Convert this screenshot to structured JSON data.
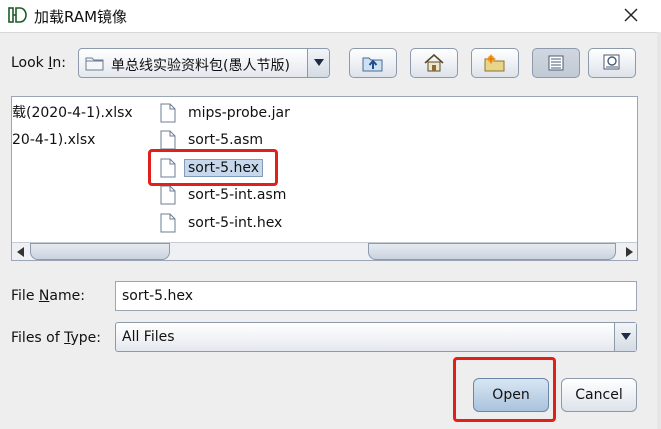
{
  "window": {
    "title": "加载RAM镜像"
  },
  "toolbar": {
    "lookin_label_prefix": "Look ",
    "lookin_label_mnemonic": "I",
    "lookin_label_suffix": "n:",
    "lookin_value": "单总线实验资料包(愚人节版)"
  },
  "file_list": {
    "partial_files": [
      "载(2020-4-1).xlsx",
      "20-4-1).xlsx"
    ],
    "files": [
      {
        "name": "mips-probe.jar",
        "selected": false
      },
      {
        "name": "sort-5.asm",
        "selected": false
      },
      {
        "name": "sort-5.hex",
        "selected": true
      },
      {
        "name": "sort-5-int.asm",
        "selected": false
      },
      {
        "name": "sort-5-int.hex",
        "selected": false
      }
    ]
  },
  "file_name": {
    "label_prefix": "File ",
    "label_mnemonic": "N",
    "label_suffix": "ame:",
    "value": "sort-5.hex"
  },
  "file_type": {
    "label_prefix": "Files of ",
    "label_mnemonic": "T",
    "label_suffix": "ype:",
    "value": "All Files"
  },
  "buttons": {
    "open": "Open",
    "cancel": "Cancel"
  },
  "colors": {
    "highlight_box": "#e0201a",
    "selection": "#c8d8ec"
  }
}
